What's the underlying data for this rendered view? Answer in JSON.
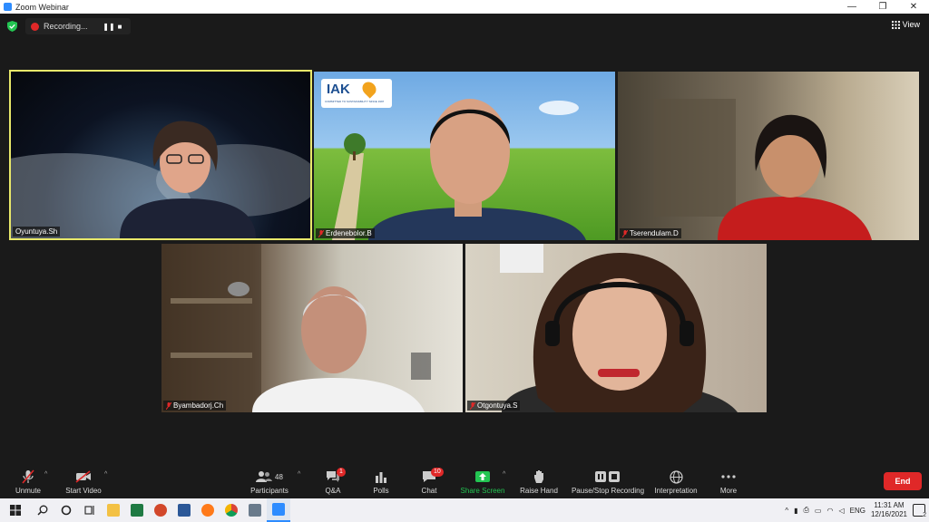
{
  "window": {
    "title": "Zoom Webinar",
    "minimize_glyph": "—",
    "maximize_glyph": "❐",
    "close_glyph": "✕"
  },
  "meeting": {
    "recording_label": "Recording...",
    "view_label": "View",
    "participants": [
      {
        "name": "Oyuntuya.Sh",
        "muted": false,
        "active_speaker": true
      },
      {
        "name": "Erdenebolor.B",
        "muted": true,
        "active_speaker": false,
        "background_logo": "IAK",
        "background_logo_sub": "COMMITTED TO SUSTAINABILITY SINCE 1997"
      },
      {
        "name": "Tserendulam.D",
        "muted": true,
        "active_speaker": false
      },
      {
        "name": "Byambadorj.Ch",
        "muted": true,
        "active_speaker": false
      },
      {
        "name": "Otgontuya.S",
        "muted": true,
        "active_speaker": false
      }
    ]
  },
  "toolbar": {
    "unmute_label": "Unmute",
    "start_video_label": "Start Video",
    "participants_label": "Participants",
    "participants_count": "48",
    "qa_label": "Q&A",
    "qa_badge": "1",
    "polls_label": "Polls",
    "chat_label": "Chat",
    "chat_badge": "10",
    "share_screen_label": "Share Screen",
    "raise_hand_label": "Raise Hand",
    "recording_label": "Pause/Stop Recording",
    "interpretation_label": "Interpretation",
    "more_label": "More",
    "end_label": "End"
  },
  "taskbar": {
    "language": "ENG",
    "time": "11:31 AM",
    "date": "12/16/2021",
    "notification_count": "2"
  },
  "colors": {
    "active_speaker_border": "#e8e86a",
    "share_green": "#23c552",
    "end_red": "#e02828",
    "badge_red": "#e02828"
  }
}
